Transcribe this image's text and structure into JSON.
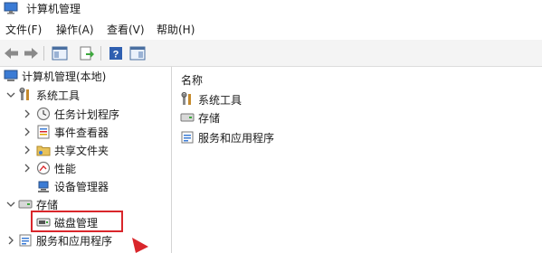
{
  "window": {
    "title": "计算机管理"
  },
  "menu": {
    "file": "文件(F)",
    "action": "操作(A)",
    "view": "查看(V)",
    "help": "帮助(H)"
  },
  "toolbar": {
    "icons": [
      "back-arrow-icon",
      "forward-arrow-icon",
      "show-hide-console-tree-icon",
      "export-list-icon",
      "help-icon",
      "action-pane-icon"
    ]
  },
  "tree": {
    "root": "计算机管理(本地)",
    "system_tools": "系统工具",
    "task_scheduler": "任务计划程序",
    "event_viewer": "事件查看器",
    "shared_folders": "共享文件夹",
    "performance": "性能",
    "device_manager": "设备管理器",
    "storage": "存储",
    "disk_management": "磁盘管理",
    "services_apps": "服务和应用程序"
  },
  "right_pane": {
    "column_header": "名称",
    "items": [
      "系统工具",
      "存储",
      "服务和应用程序"
    ]
  },
  "colors": {
    "highlight": "#d9262b",
    "annotation_arrow": "#d9262b"
  }
}
